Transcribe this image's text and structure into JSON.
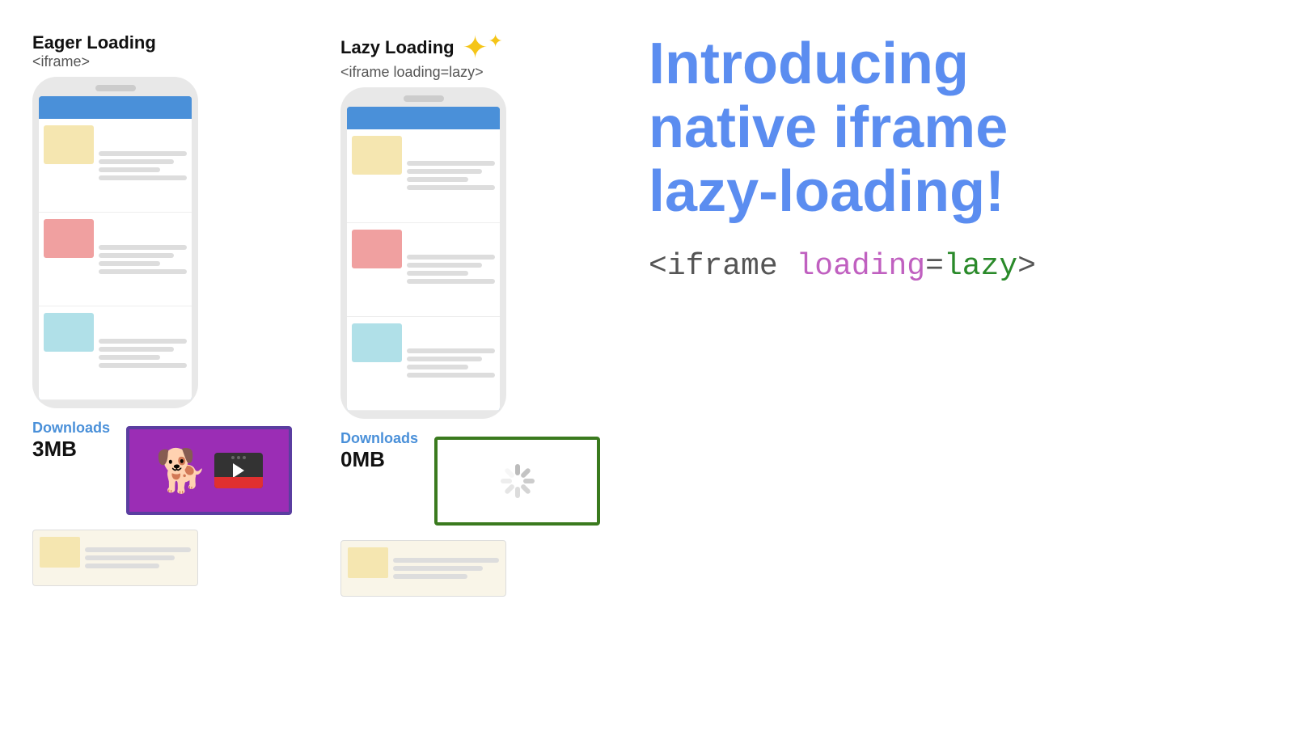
{
  "eager": {
    "title": "Eager Loading",
    "subtitle": "<iframe>",
    "downloads_label": "Downloads",
    "downloads_value": "3MB"
  },
  "lazy": {
    "title": "Lazy Loading",
    "subtitle": "<iframe loading=lazy>",
    "downloads_label": "Downloads",
    "downloads_value": "0MB"
  },
  "intro": {
    "line1": "Introducing",
    "line2": "native iframe",
    "line3": "lazy-loading!"
  },
  "code": {
    "part1": "<iframe ",
    "part2": "loading",
    "part3": "=",
    "part4": "lazy",
    "part5": ">"
  },
  "colors": {
    "blue": "#5b8df0",
    "purple": "#c060c0",
    "green": "#2a8a2a",
    "dark": "#333",
    "phone_blue": "#4a90d9",
    "sparkle": "#f5c518"
  }
}
